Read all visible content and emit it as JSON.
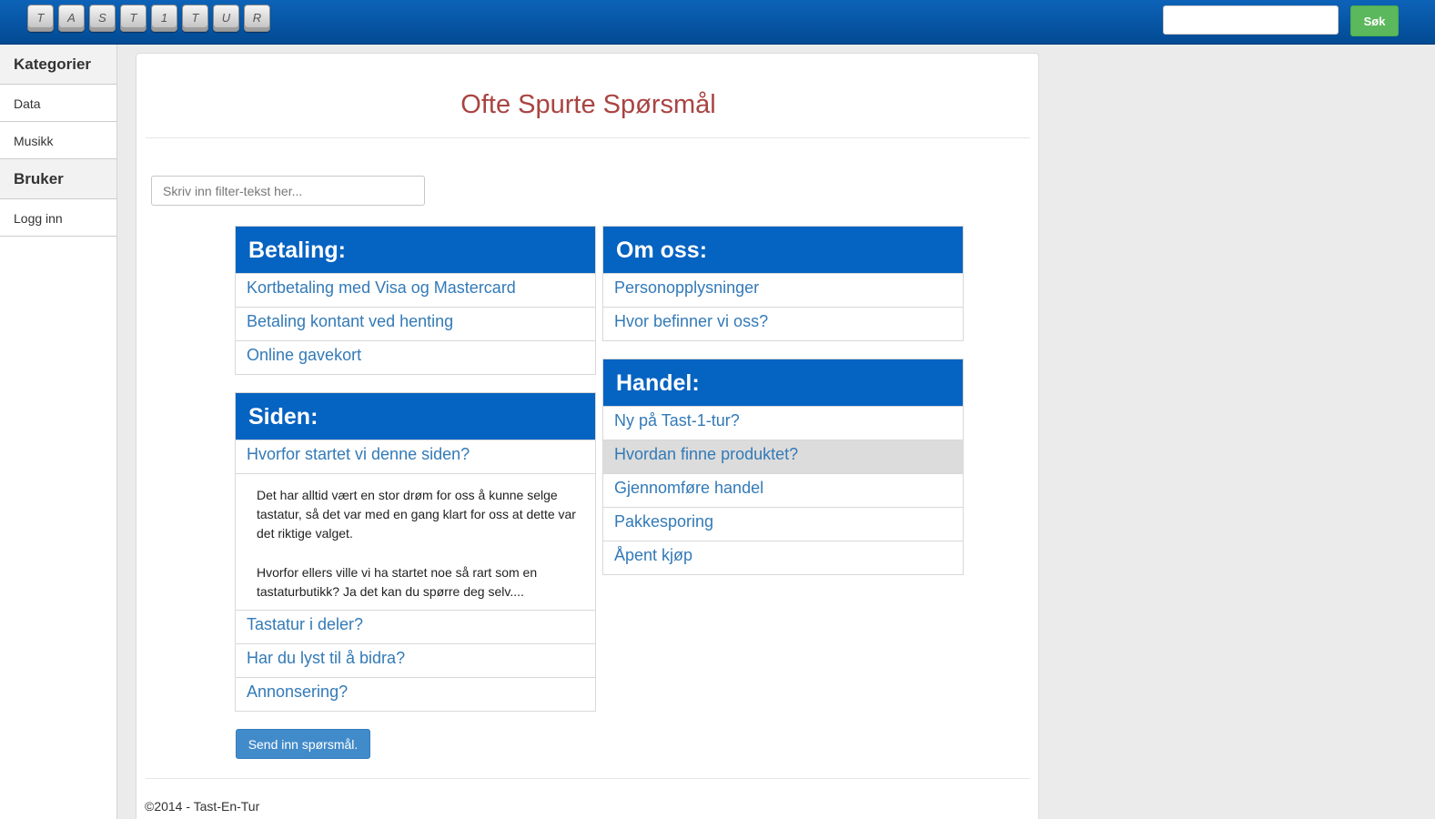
{
  "header": {
    "logo_keys": [
      "T",
      "A",
      "S",
      "T",
      "1",
      "T",
      "U",
      "R"
    ],
    "search": {
      "value": "",
      "button_label": "Søk"
    }
  },
  "sidebar": {
    "sections": [
      {
        "title": "Kategorier",
        "items": [
          "Data",
          "Musikk"
        ]
      },
      {
        "title": "Bruker",
        "items": [
          "Logg inn"
        ]
      }
    ]
  },
  "main": {
    "title": "Ofte Spurte Spørsmål",
    "filter_placeholder": "Skriv inn filter-tekst her...",
    "faq": {
      "betaling": {
        "heading": "Betaling:",
        "questions": [
          "Kortbetaling med Visa og Mastercard",
          "Betaling kontant ved henting",
          "Online gavekort"
        ]
      },
      "siden": {
        "heading": "Siden:",
        "questions": [
          "Hvorfor startet vi denne siden?",
          "Tastatur i deler?",
          "Har du lyst til å bidra?",
          "Annonsering?"
        ],
        "open_answer": {
          "p1": "Det har alltid vært en stor drøm for oss å kunne selge tastatur, så det var med en gang klart for oss at dette var det riktige valget.",
          "p2": "Hvorfor ellers ville vi ha startet noe så rart som en tastaturbutikk? Ja det kan du spørre deg selv...."
        }
      },
      "om_oss": {
        "heading": "Om oss:",
        "questions": [
          "Personopplysninger",
          "Hvor befinner vi oss?"
        ]
      },
      "handel": {
        "heading": "Handel:",
        "questions": [
          "Ny på Tast-1-tur?",
          "Hvordan finne produktet?",
          "Gjennomføre handel",
          "Pakkesporing",
          "Åpent kjøp"
        ]
      }
    },
    "send_button": "Send inn spørsmål.",
    "footer": "©2014 - Tast-En-Tur"
  },
  "colors": {
    "header_blue": "#0563c1",
    "title_red": "#a94442",
    "link_blue": "#337ab7",
    "search_green": "#5cb85c",
    "button_blue": "#428bca"
  }
}
